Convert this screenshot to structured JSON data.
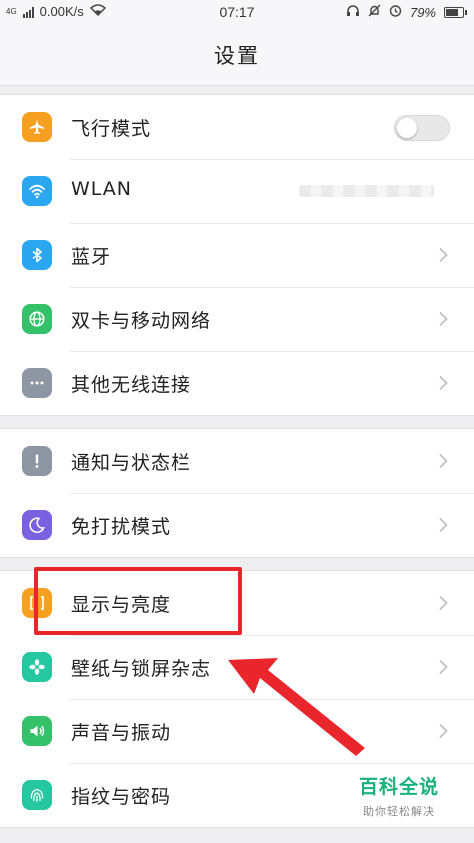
{
  "status_bar": {
    "network_tag": "4G",
    "speed": "0.00K/s",
    "time": "07:17",
    "battery": "79%",
    "battery_level": 0.79
  },
  "header": {
    "title": "设置"
  },
  "groups": [
    {
      "rows": [
        {
          "label": "飞行模式",
          "icon": "airplane-icon",
          "color": "#f5a021",
          "control": "toggle",
          "toggle_on": false
        },
        {
          "label": "WLAN",
          "icon": "wifi-icon",
          "color": "#2aa7f0",
          "control": "value-blurred"
        },
        {
          "label": "蓝牙",
          "icon": "bluetooth-icon",
          "color": "#2aa7f0",
          "control": "chevron"
        },
        {
          "label": "双卡与移动网络",
          "icon": "globe-icon",
          "color": "#35c06a",
          "control": "chevron"
        },
        {
          "label": "其他无线连接",
          "icon": "more-dots-icon",
          "color": "#8e96a3",
          "control": "chevron"
        }
      ]
    },
    {
      "rows": [
        {
          "label": "通知与状态栏",
          "icon": "exclamation-icon",
          "color": "#8e96a3",
          "control": "chevron"
        },
        {
          "label": "免打扰模式",
          "icon": "moon-icon",
          "color": "#7a61e0",
          "control": "chevron"
        }
      ]
    },
    {
      "rows": [
        {
          "label": "显示与亮度",
          "icon": "brightness-icon",
          "color": "#f5a021",
          "control": "chevron"
        },
        {
          "label": "壁纸与锁屏杂志",
          "icon": "flower-icon",
          "color": "#25c7a1",
          "control": "chevron"
        },
        {
          "label": "声音与振动",
          "icon": "speaker-icon",
          "color": "#35c06a",
          "control": "chevron"
        },
        {
          "label": "指纹与密码",
          "icon": "fingerprint-icon",
          "color": "#25c7a1",
          "control": "chevron"
        }
      ]
    }
  ],
  "annotation": {
    "highlight_color": "#e8262b"
  },
  "watermark": {
    "title": "百科全说",
    "subtitle": "助你轻松解决",
    "color": "#16b27a"
  }
}
